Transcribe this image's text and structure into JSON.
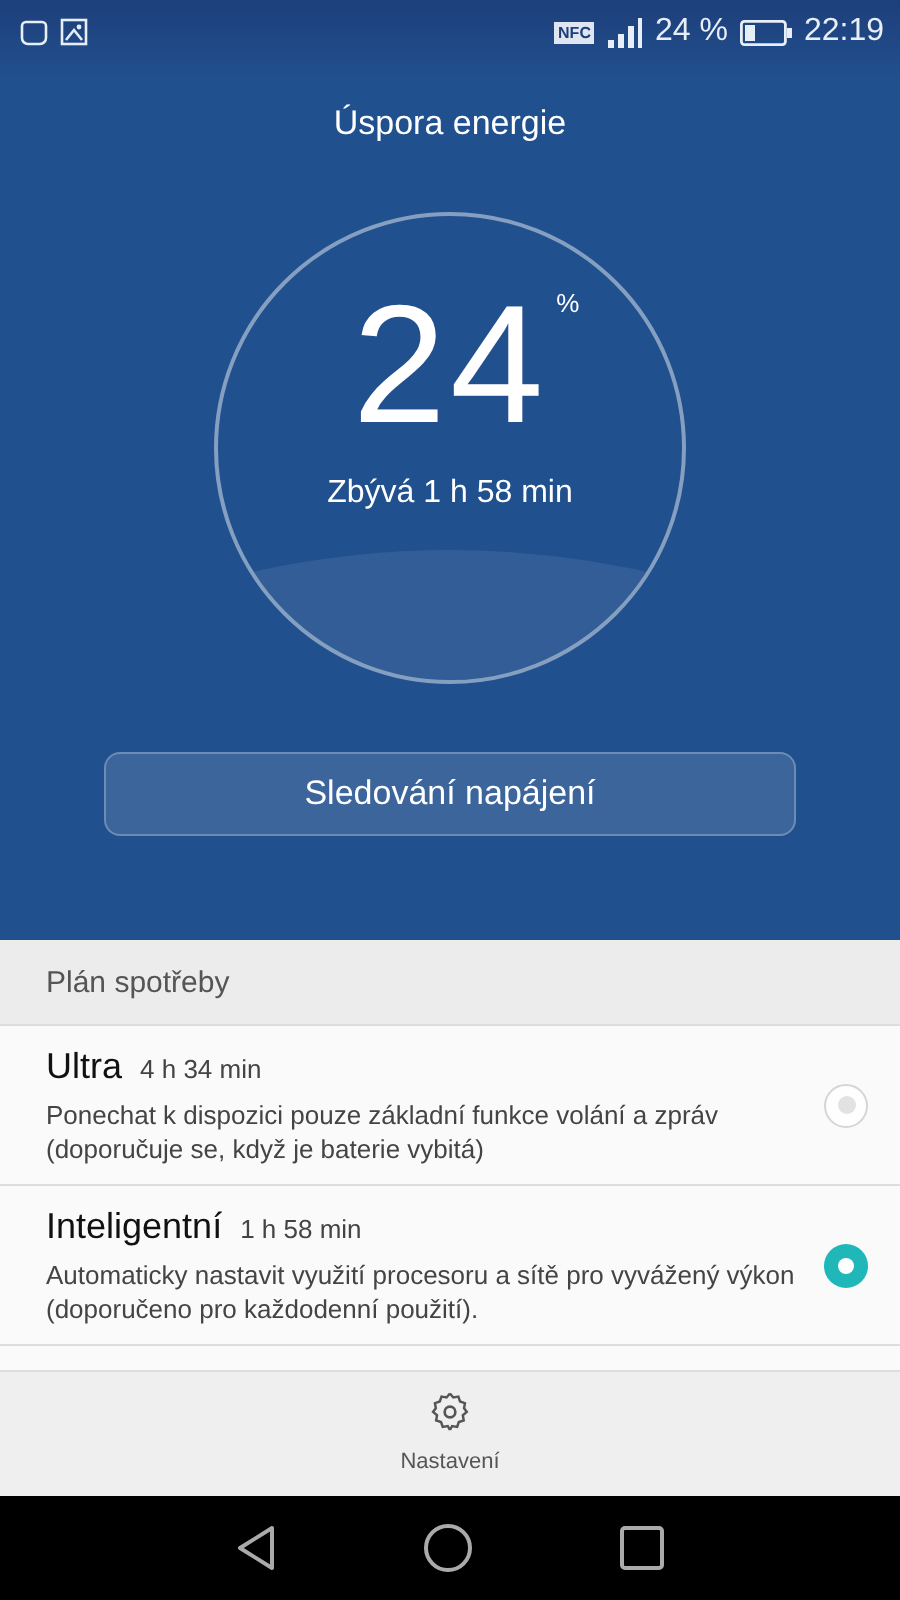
{
  "status_bar": {
    "nfc": "NFC",
    "battery": "24 %",
    "time": "22:19"
  },
  "header": {
    "title": "Úspora energie"
  },
  "gauge": {
    "value": "24",
    "unit": "%",
    "remaining": "Zbývá 1 h 58 min"
  },
  "monitor_button": "Sledování napájení",
  "plan": {
    "heading": "Plán spotřeby",
    "options": [
      {
        "name": "Ultra",
        "time": "4 h 34 min",
        "description": "Ponechat k dispozici pouze základní funkce volání a zpráv (doporučuje se, když je baterie vybitá)",
        "selected": false,
        "disabled": true
      },
      {
        "name": "Inteligentní",
        "time": "1 h 58 min",
        "description": "Automaticky nastavit využití procesoru a sítě pro vyvážený výkon (doporučeno pro každodenní použití).",
        "selected": true,
        "disabled": false
      }
    ]
  },
  "settings_button": "Nastavení"
}
